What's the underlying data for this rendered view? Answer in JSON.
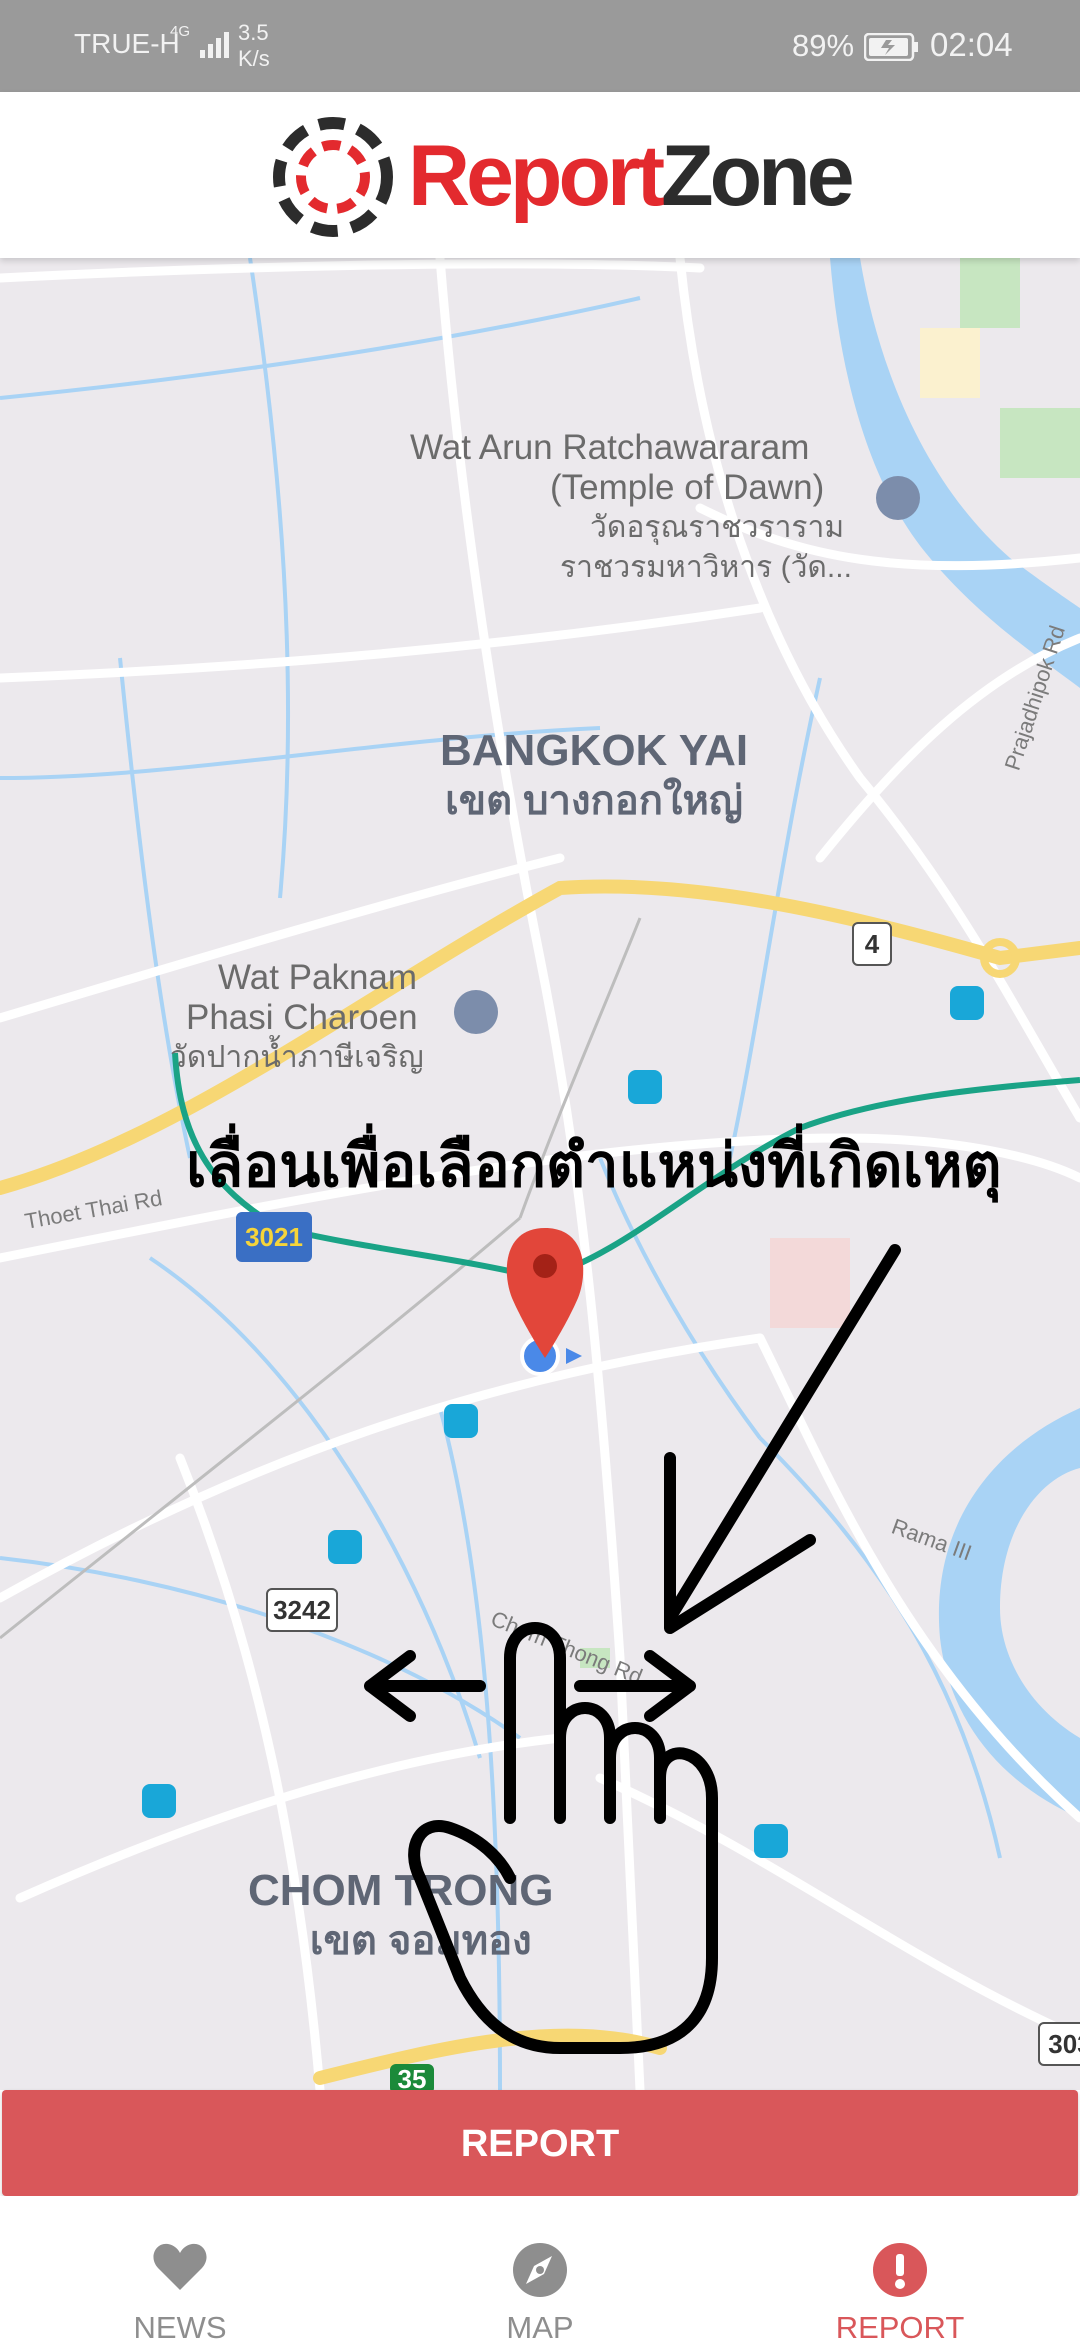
{
  "status_bar": {
    "carrier": "TRUE-H",
    "network_type": "4G",
    "data_speed": "3.5 K/s",
    "battery_percent": "89%",
    "time": "02:04"
  },
  "header": {
    "logo_report": "Report",
    "logo_zone": "Zone",
    "logo_colors": {
      "red": "#e32a2e",
      "dark": "#2c2c2c"
    }
  },
  "map": {
    "landmarks": [
      {
        "en": "Wat Arun Ratchawararam",
        "en2": "(Temple of Dawn)",
        "th": "วัดอรุณราชวราราม",
        "th2": "ราชวรมหาวิหาร (วัด..."
      },
      {
        "en": "Wat Paknam",
        "en2": "Phasi Charoen",
        "th": "วัดปากน้ำภาษีเจริญ"
      }
    ],
    "districts": [
      {
        "en": "BANGKOK YAI",
        "th": "เขต บางกอกใหญ่"
      },
      {
        "en": "CHOM TRONG",
        "th": "เขต จอมทอง"
      }
    ],
    "streets": [
      "Prajadhipok Rd",
      "Thoet Thai Rd",
      "Rama III",
      "Chom Thong Rd"
    ],
    "route_numbers": [
      "4",
      "3021",
      "3242",
      "35",
      "303"
    ],
    "instruction_text": "เลื่อนเพื่อเลือกตำแหน่งที่เกิดเหตุ",
    "icons": [
      "location-pin-icon",
      "current-location-dot-icon",
      "swipe-hand-gesture-icon",
      "temple-icon",
      "train-station-icon"
    ]
  },
  "report_button": {
    "label": "REPORT",
    "color": "#d9575a"
  },
  "bottom_nav": {
    "items": [
      {
        "label": "NEWS",
        "icon": "heart-icon",
        "active": false
      },
      {
        "label": "MAP",
        "icon": "compass-icon",
        "active": false
      },
      {
        "label": "REPORT",
        "icon": "alert-icon",
        "active": true
      }
    ]
  }
}
